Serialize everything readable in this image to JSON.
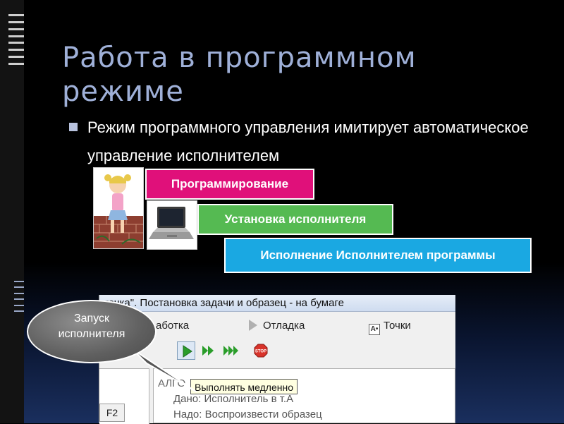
{
  "slide": {
    "title": "Работа в программном\nрежиме",
    "bullet": "Режим программного управления имитирует автоматическое управление исполнителем"
  },
  "steps": [
    {
      "label": "Программирование",
      "color": "#e0107a"
    },
    {
      "label": "Установка исполнителя",
      "color": "#55ba52"
    },
    {
      "label": "Исполнение Исполнителем программы",
      "color": "#1aa8e2"
    }
  ],
  "window": {
    "title": "точка\". Постановка задачи и образец - на бумаге",
    "menu": {
      "work": "аботка",
      "debug": "Отладка",
      "points": "Точки",
      "points_icon_text": "A•"
    },
    "toolbar": {
      "run_icon": "play-icon",
      "step_icon": "fast-forward-icon",
      "run_fast_icon": "triple-forward-icon",
      "stop_icon": "stop-icon",
      "stop_label": "STOP",
      "accent": "#2a9d2a",
      "stop_color": "#d8332a"
    },
    "tooltip": "Выполнять медленно",
    "key_label": "F2",
    "code": [
      "АЛГО",
      "Дано: Исполнитель в т.А",
      "Надо: Воспроизвести образец"
    ]
  },
  "callout": {
    "text": "Запуск\nисполнителя"
  }
}
